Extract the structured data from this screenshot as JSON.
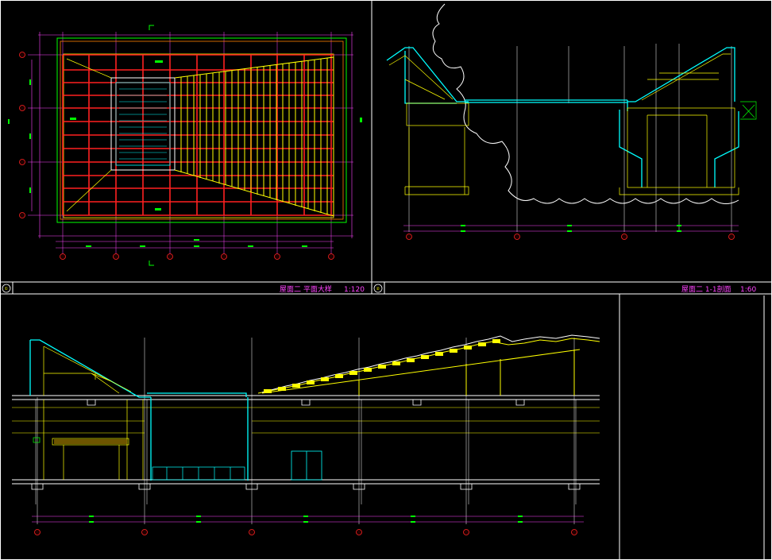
{
  "sheet": {
    "panels": [
      {
        "id": "plan",
        "number": "①",
        "title": "屋面二 平面大样",
        "scale": "1:120"
      },
      {
        "id": "section",
        "number": "②",
        "title": "屋面二 1-1剖面",
        "scale": "1:60"
      }
    ]
  },
  "colors": {
    "background": "#000000",
    "frame": "#ffffff",
    "grid_red": "#ff2020",
    "beam_yellow": "#ffff00",
    "wall_cyan": "#00ffff",
    "axis_magenta": "#ff44ff",
    "dim_green": "#00ff00",
    "gray": "#b0b0b0",
    "orange": "#ff8000"
  }
}
